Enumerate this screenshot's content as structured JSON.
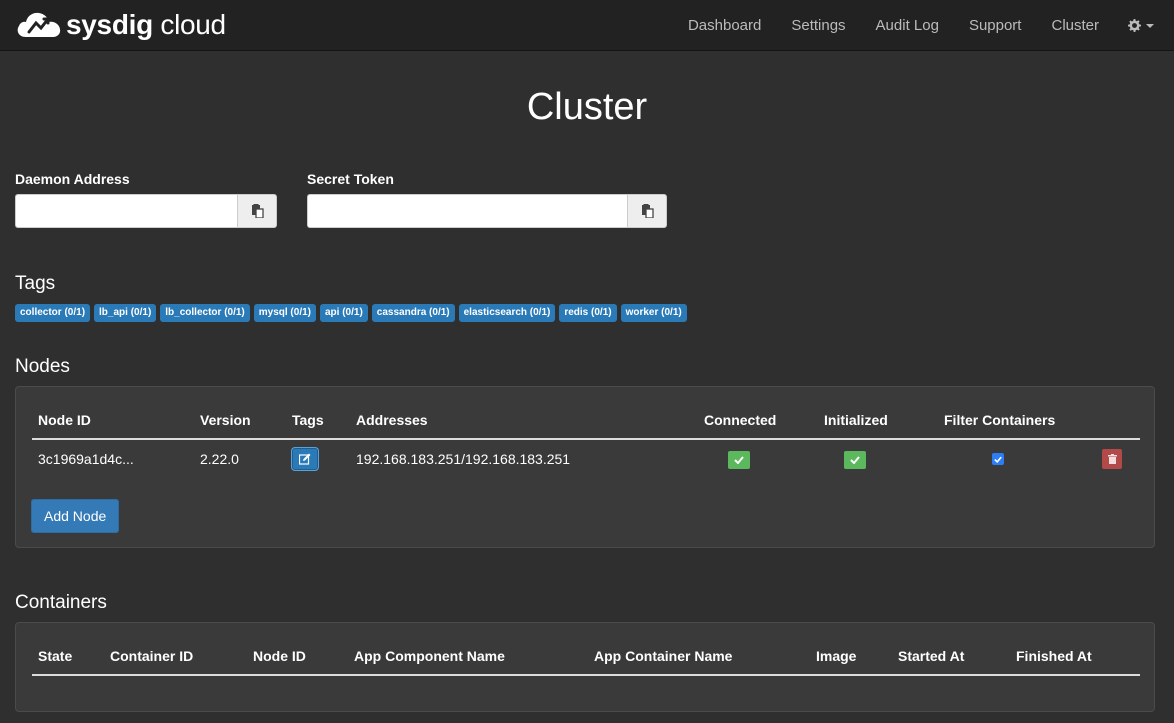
{
  "brand": {
    "name_bold": "sysdig",
    "name_light": " cloud",
    "logo_icon": "cloud-logo-icon"
  },
  "nav": {
    "links": [
      "Dashboard",
      "Settings",
      "Audit Log",
      "Support",
      "Cluster"
    ],
    "settings_icon": "gear-icon"
  },
  "page": {
    "title": "Cluster"
  },
  "daemon": {
    "label": "Daemon Address",
    "value": "",
    "copy_icon": "clipboard-icon"
  },
  "secret": {
    "label": "Secret Token",
    "value": "",
    "copy_icon": "clipboard-icon"
  },
  "tags": {
    "title": "Tags",
    "items": [
      "collector (0/1)",
      "lb_api (0/1)",
      "lb_collector (0/1)",
      "mysql (0/1)",
      "api (0/1)",
      "cassandra (0/1)",
      "elasticsearch (0/1)",
      "redis (0/1)",
      "worker (0/1)"
    ],
    "color": "#2a7ab8"
  },
  "nodes": {
    "title": "Nodes",
    "columns": [
      "Node ID",
      "Version",
      "Tags",
      "Addresses",
      "Connected",
      "Initialized",
      "Filter Containers"
    ],
    "rows": [
      {
        "node_id": "3c1969a1d4c...",
        "version": "2.22.0",
        "addresses": "192.168.183.251/192.168.183.251",
        "connected": true,
        "initialized": true,
        "filter_containers": true
      }
    ],
    "add_label": "Add Node",
    "colors": {
      "success": "#5cb85c",
      "danger": "#b14a48",
      "primary": "#337ab7"
    }
  },
  "containers": {
    "title": "Containers",
    "columns": [
      "State",
      "Container ID",
      "Node ID",
      "App Component Name",
      "App Container Name",
      "Image",
      "Started At",
      "Finished At"
    ],
    "rows": []
  }
}
